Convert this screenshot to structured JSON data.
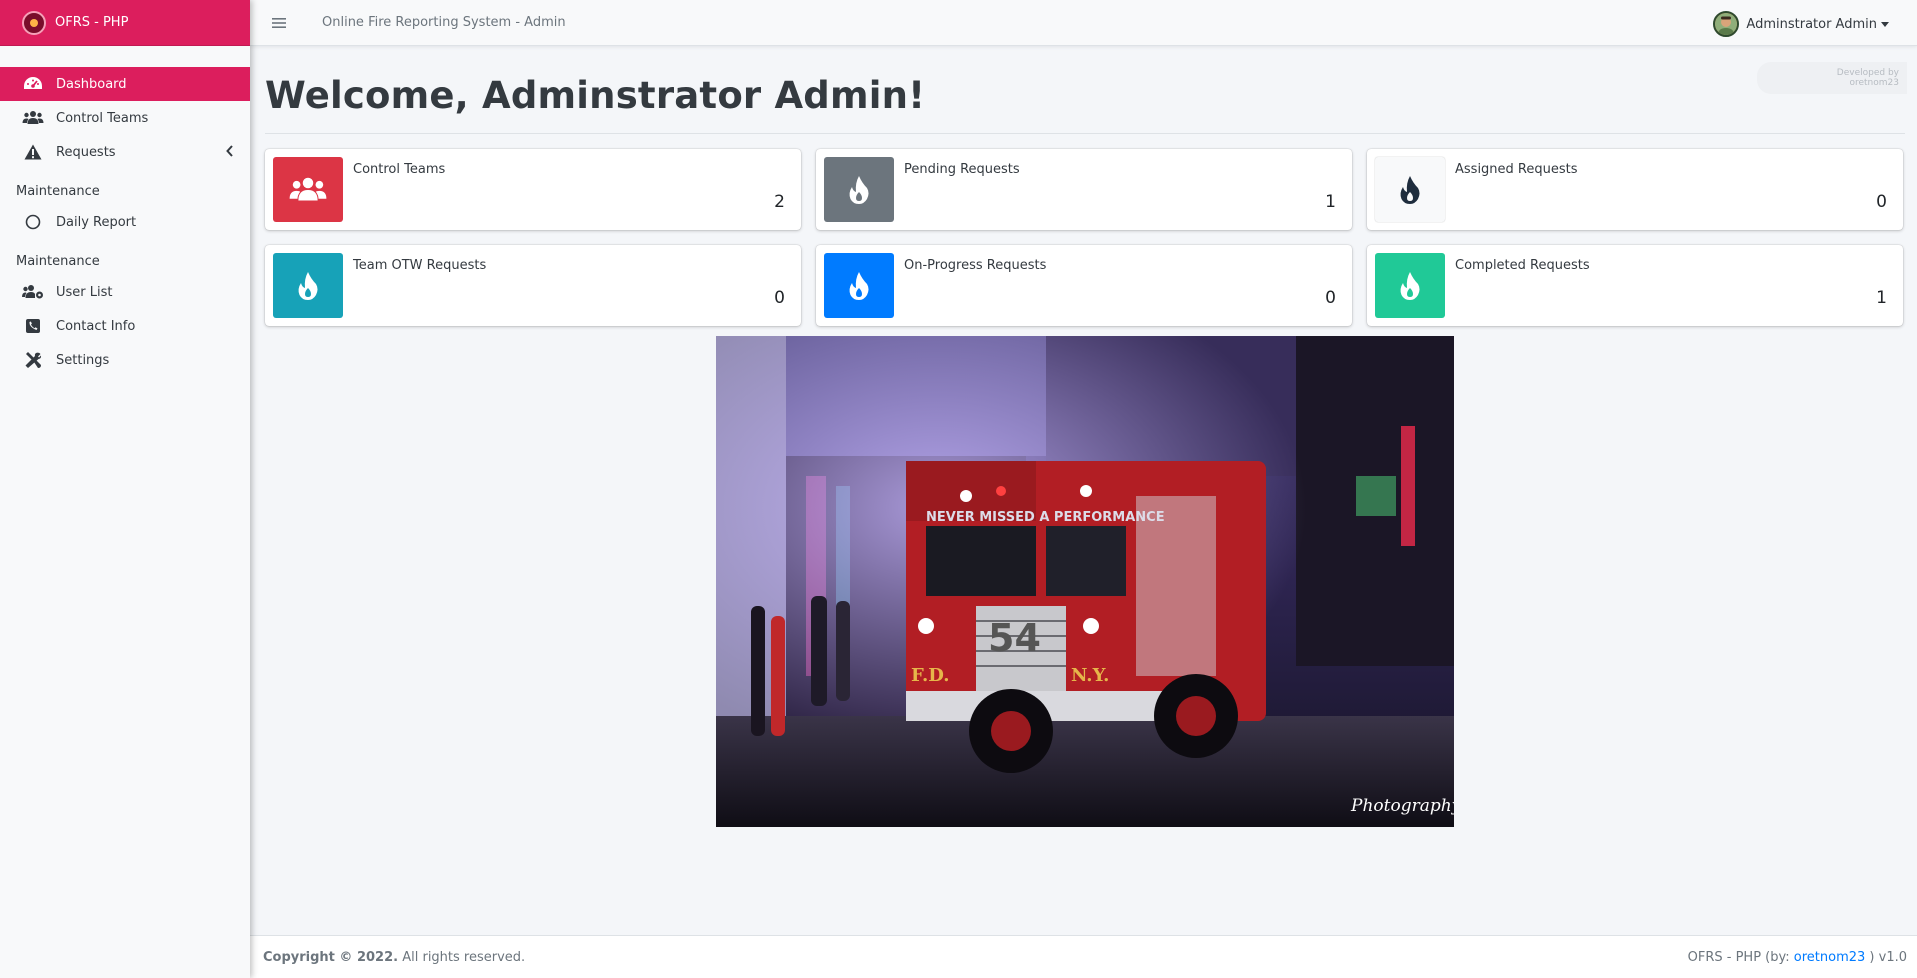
{
  "brand": {
    "name": "OFRS - PHP"
  },
  "topbar": {
    "title": "Online Fire Reporting System - Admin",
    "user": "Adminstrator Admin"
  },
  "sidebar": {
    "items": [
      {
        "label": "Dashboard",
        "icon": "dashboard-icon"
      },
      {
        "label": "Control Teams",
        "icon": "users-icon"
      },
      {
        "label": "Requests",
        "icon": "warning-icon"
      }
    ],
    "section1": "Maintenance",
    "section1_items": [
      {
        "label": "Daily Report",
        "icon": "circle-icon"
      }
    ],
    "section2": "Maintenance",
    "section2_items": [
      {
        "label": "User List",
        "icon": "users-cog-icon"
      },
      {
        "label": "Contact Info",
        "icon": "phone-icon"
      },
      {
        "label": "Settings",
        "icon": "tools-icon"
      }
    ]
  },
  "dev_tag": "Developed by oretnom23",
  "main": {
    "welcome": "Welcome, Adminstrator Admin!",
    "boxes": [
      {
        "label": "Control Teams",
        "value": "2",
        "color": "#dc3545",
        "icon": "users-icon"
      },
      {
        "label": "Pending Requests",
        "value": "1",
        "color": "#6c757d",
        "icon": "fire-icon"
      },
      {
        "label": "Assigned Requests",
        "value": "0",
        "color": "#f8f9fa",
        "icon": "fire-icon"
      },
      {
        "label": "Team OTW Requests",
        "value": "0",
        "color": "#17a2b8",
        "icon": "fire-icon"
      },
      {
        "label": "On-Progress Requests",
        "value": "0",
        "color": "#007bff",
        "icon": "fire-icon"
      },
      {
        "label": "Completed Requests",
        "value": "1",
        "color": "#20c997",
        "icon": "fire-icon"
      }
    ],
    "hero": {
      "truck_text": "NEVER MISSED A PERFORMANCE",
      "unit": "54",
      "left_badge": "F.D.",
      "right_badge": "N.Y.",
      "watermark": "Photography"
    }
  },
  "footer": {
    "copyright": "Copyright © 2022.",
    "rights": "All rights reserved.",
    "credit_prefix": "OFRS - PHP (by:",
    "credit_link": "oretnom23",
    "credit_suffix": ") v1.0"
  }
}
